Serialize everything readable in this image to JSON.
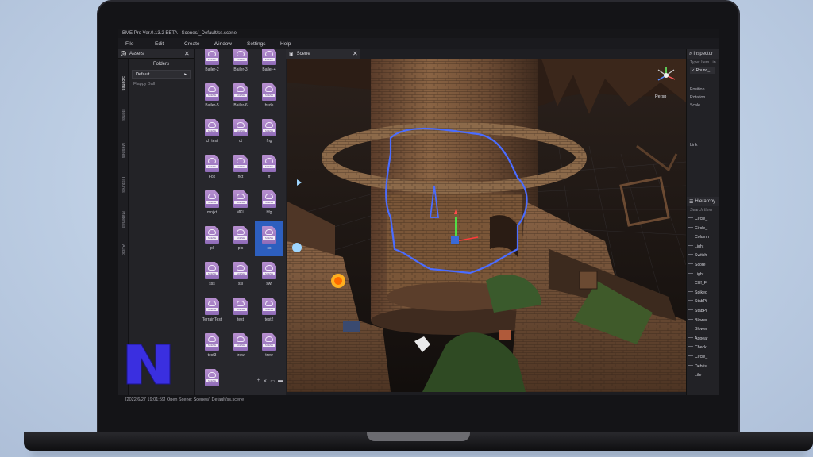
{
  "app": {
    "title": "BME Pro Ver.0.13.2 BETA  - Scenes/_Default/ss.scene",
    "menu": [
      "File",
      "Edit",
      "Create",
      "Window",
      "Settings",
      "Help"
    ],
    "status": "[2022/6/27 19:01:59] Open Scene: Scenes/_Default/ss.scene"
  },
  "assets_panel": {
    "title": "Assets",
    "tabs": [
      "Scenes",
      "Items",
      "Meshes",
      "Textures",
      "Materials",
      "Audio"
    ],
    "folders_title": "Folders",
    "folder_selected": "Default",
    "folder_other": "Flappy Ball",
    "file_tag": "SCENE",
    "files": [
      "Bailer-2",
      "Bailer-3",
      "Bailer-4",
      "Bailer-5",
      "Bailer-6",
      "bsde",
      "ch test",
      "ct",
      "fhg",
      "Fox",
      "hct",
      "ff",
      "mnjkt",
      "MKL",
      "hfg",
      "pl",
      "plc",
      "ss",
      "sss",
      "ssl",
      "swf",
      "TerrainTest",
      "test",
      "test2",
      "test3",
      "trew",
      "trew",
      ""
    ],
    "selected_file": "ss"
  },
  "scene_panel": {
    "title": "Scene",
    "view_label": "Persp"
  },
  "inspector": {
    "title": "Inspector",
    "type_label": "Type: Item Lin",
    "object_name": "Round_",
    "fields": [
      "Position",
      "Rotation",
      "Scale"
    ],
    "link_label": "Link"
  },
  "hierarchy": {
    "title": "Hierarchy",
    "search_placeholder": "Search Item",
    "items": [
      "Circle_",
      "Circle_",
      "Column",
      "Light",
      "Switch",
      "Score",
      "Light",
      "Cliff_F",
      "Spiked",
      "StabPi",
      "StabPi",
      "Blower",
      "Blower",
      "Appear",
      "Checkl",
      "Circle_",
      "Debris",
      "Life"
    ]
  },
  "colors": {
    "accent_blue": "#2d5fbf",
    "logo_blue": "#3a2fe0",
    "path_outline": "#4a6cff"
  }
}
